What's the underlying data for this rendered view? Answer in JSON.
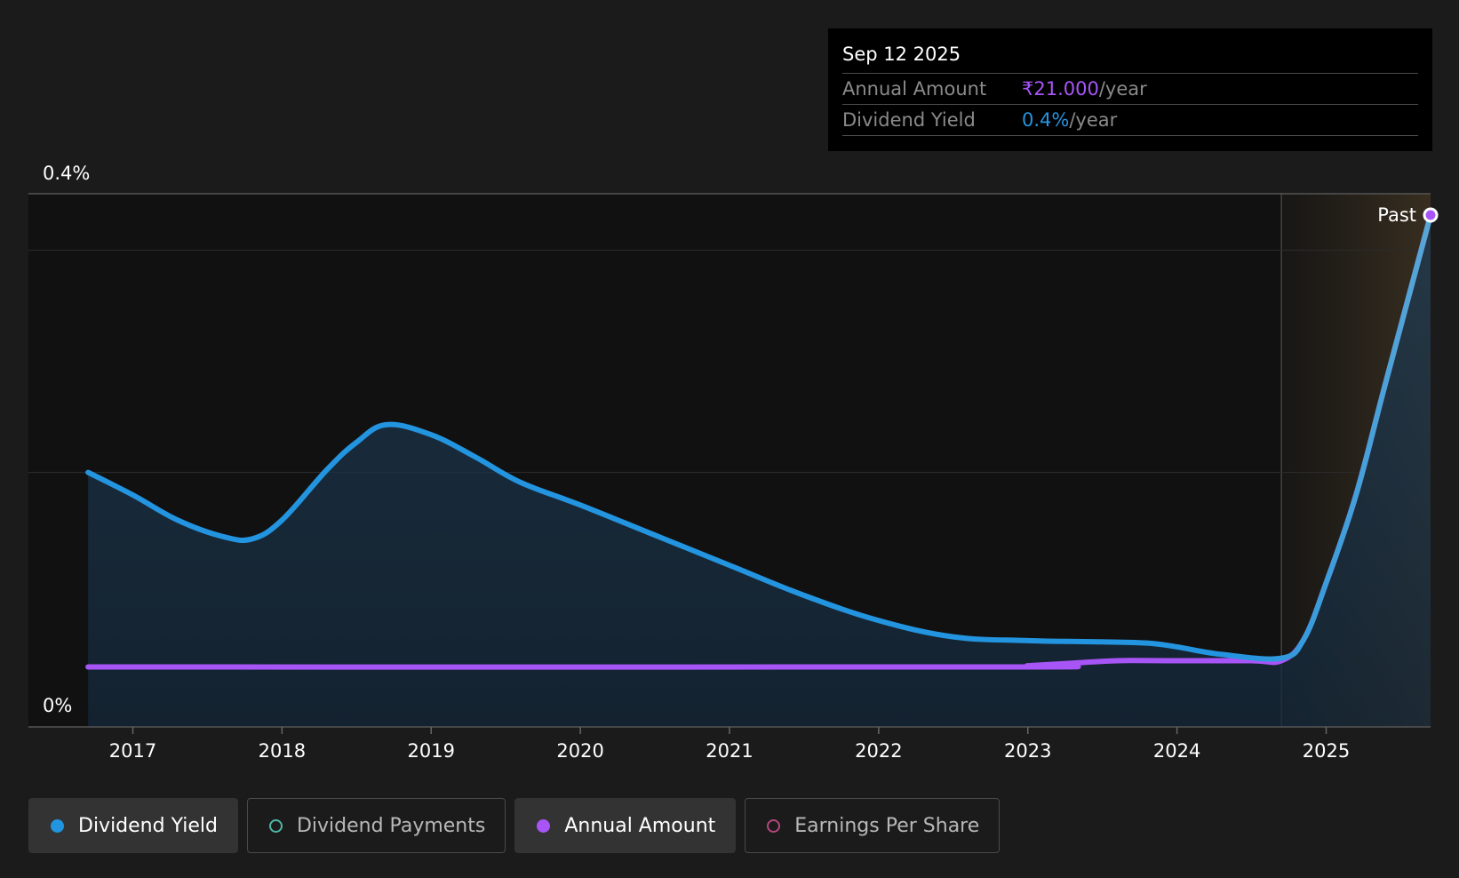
{
  "colors": {
    "background": "#1b1b1b",
    "plot_background": "#111111",
    "dividend_yield": "#2394df",
    "annual_amount": "#a855f7",
    "dividend_payments": "#4fb6a6",
    "earnings_per_share": "#b5467e",
    "past_band": "#3a2f20"
  },
  "tooltip": {
    "date": "Sep 12 2025",
    "rows": [
      {
        "label": "Annual Amount",
        "value": "₹21.000",
        "unit": "/year"
      },
      {
        "label": "Dividend Yield",
        "value": "0.4%",
        "unit": "/year"
      }
    ]
  },
  "past_label": "Past",
  "legend": [
    {
      "label": "Dividend Yield",
      "icon": "filled-circle-icon",
      "color": "#2394df",
      "active": true
    },
    {
      "label": "Dividend Payments",
      "icon": "hollow-circle-icon",
      "color": "#4fb6a6",
      "active": false
    },
    {
      "label": "Annual Amount",
      "icon": "filled-circle-icon",
      "color": "#a855f7",
      "active": true
    },
    {
      "label": "Earnings Per Share",
      "icon": "hollow-circle-icon",
      "color": "#b5467e",
      "active": false
    }
  ],
  "chart_data": {
    "type": "area",
    "title": "",
    "xlabel": "",
    "ylabel": "",
    "y_tick_labels": [
      "0.4%",
      "0%"
    ],
    "ylim": [
      0,
      0.4
    ],
    "xlim": [
      2016.3,
      2025.7
    ],
    "x_ticks": [
      2017,
      2018,
      2019,
      2020,
      2021,
      2022,
      2023,
      2024,
      2025
    ],
    "grid": true,
    "past_region_start": 2024.7,
    "series": [
      {
        "name": "Dividend Yield",
        "x": [
          2016.7,
          2017.0,
          2017.3,
          2017.6,
          2017.8,
          2018.0,
          2018.3,
          2018.5,
          2018.7,
          2019.0,
          2019.3,
          2019.6,
          2020.0,
          2020.5,
          2021.0,
          2021.5,
          2022.0,
          2022.5,
          2023.0,
          2023.5,
          2023.8,
          2024.0,
          2024.3,
          2024.7,
          2024.85,
          2025.0,
          2025.2,
          2025.4,
          2025.7
        ],
        "y": [
          0.178,
          0.16,
          0.14,
          0.127,
          0.125,
          0.14,
          0.18,
          0.202,
          0.216,
          0.208,
          0.19,
          0.17,
          0.152,
          0.128,
          0.104,
          0.08,
          0.06,
          0.047,
          0.044,
          0.043,
          0.042,
          0.039,
          0.033,
          0.03,
          0.045,
          0.09,
          0.16,
          0.25,
          0.383
        ]
      },
      {
        "name": "Annual Amount",
        "x": [
          2016.7,
          2022.8,
          2023.0,
          2023.3,
          2023.6,
          2024.0,
          2024.5,
          2024.7,
          2024.85,
          2025.0,
          2025.2,
          2025.4,
          2025.7
        ],
        "y": [
          0.023,
          0.023,
          0.024,
          0.026,
          0.028,
          0.028,
          0.028,
          0.028,
          0.045,
          0.09,
          0.16,
          0.25,
          0.383
        ]
      }
    ]
  }
}
